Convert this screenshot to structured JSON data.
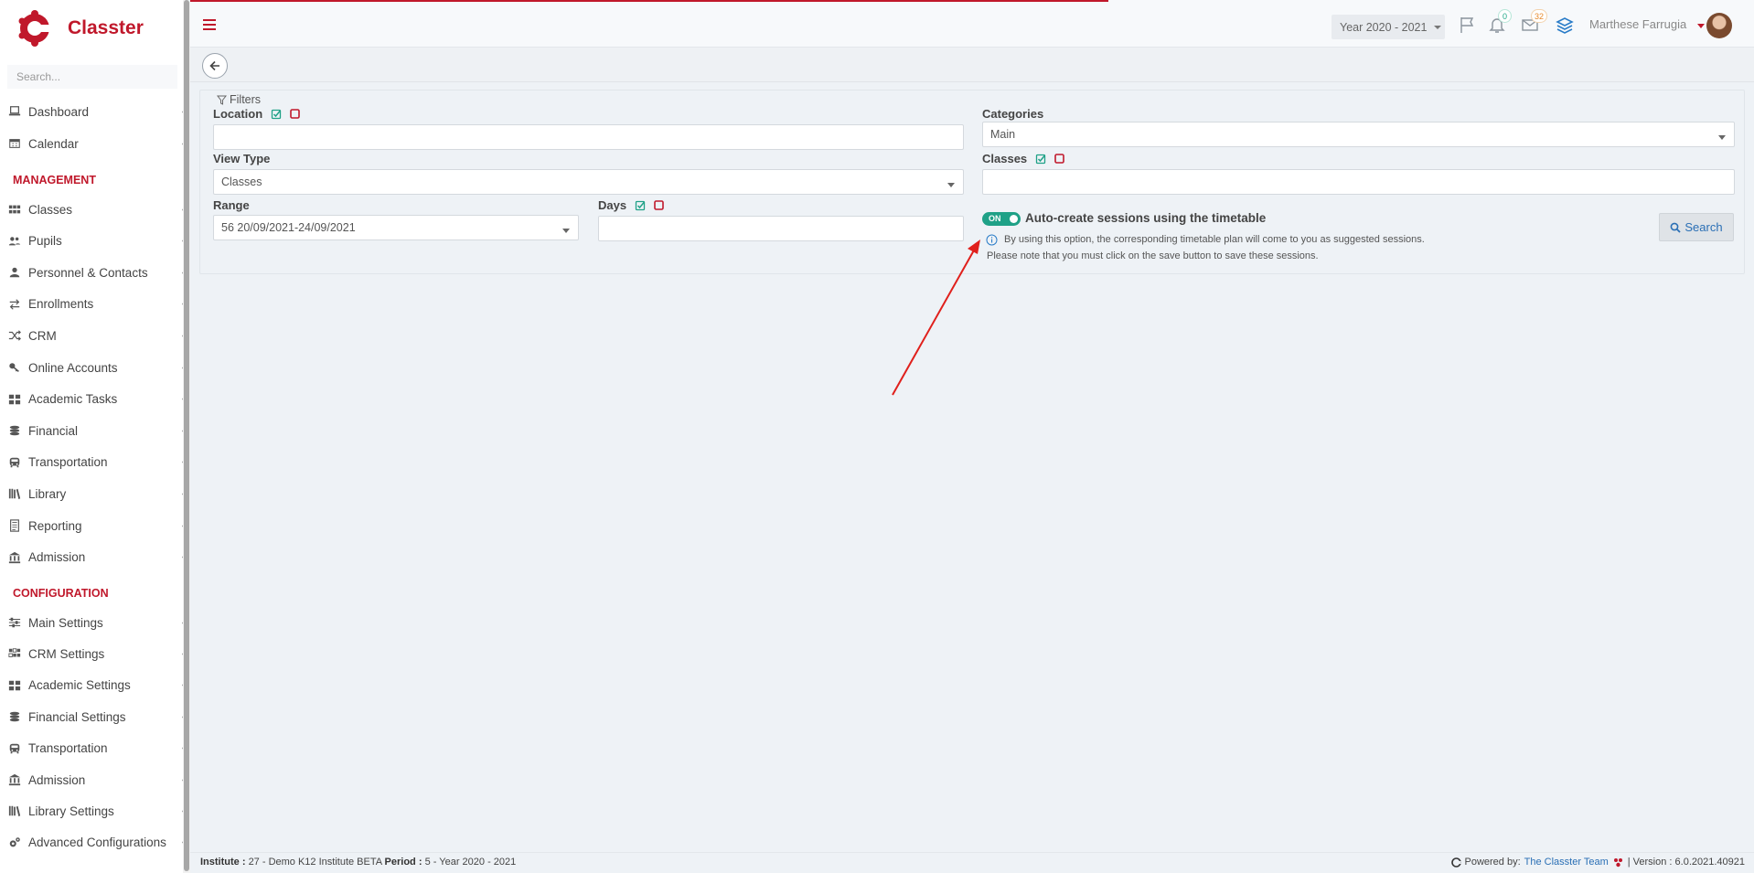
{
  "app": {
    "name": "Classter"
  },
  "sidebar": {
    "search_placeholder": "Search...",
    "items_top": [
      {
        "label": "Dashboard",
        "icon": "laptop-icon"
      },
      {
        "label": "Calendar",
        "icon": "calendar-icon"
      }
    ],
    "management_heading": "MANAGEMENT",
    "management_items": [
      {
        "label": "Classes",
        "icon": "classes-icon"
      },
      {
        "label": "Pupils",
        "icon": "pupils-icon"
      },
      {
        "label": "Personnel & Contacts",
        "icon": "person-icon"
      },
      {
        "label": "Enrollments",
        "icon": "exchange-icon"
      },
      {
        "label": "CRM",
        "icon": "shuffle-icon"
      },
      {
        "label": "Online Accounts",
        "icon": "key-icon"
      },
      {
        "label": "Academic Tasks",
        "icon": "grid-icon"
      },
      {
        "label": "Financial",
        "icon": "coins-icon"
      },
      {
        "label": "Transportation",
        "icon": "bus-icon"
      },
      {
        "label": "Library",
        "icon": "books-icon"
      },
      {
        "label": "Reporting",
        "icon": "report-icon"
      },
      {
        "label": "Admission",
        "icon": "institution-icon"
      }
    ],
    "configuration_heading": "CONFIGURATION",
    "configuration_items": [
      {
        "label": "Main Settings",
        "icon": "sliders-icon"
      },
      {
        "label": "CRM Settings",
        "icon": "crm-grid-icon"
      },
      {
        "label": "Academic Settings",
        "icon": "grid-icon"
      },
      {
        "label": "Financial Settings",
        "icon": "coins-icon"
      },
      {
        "label": "Transportation",
        "icon": "bus-icon"
      },
      {
        "label": "Admission",
        "icon": "institution-icon"
      },
      {
        "label": "Library Settings",
        "icon": "books-icon"
      },
      {
        "label": "Advanced Configurations",
        "icon": "gears-icon"
      }
    ]
  },
  "topbar": {
    "year_label": "Year 2020 - 2021",
    "notifications_count": "0",
    "messages_count": "32",
    "user_name": "Marthese Farrugia"
  },
  "filters": {
    "title": "Filters",
    "location_label": "Location",
    "location_value": "",
    "view_type_label": "View Type",
    "view_type_value": "Classes",
    "range_label": "Range",
    "range_value": "56 20/09/2021-24/09/2021",
    "days_label": "Days",
    "days_value": "",
    "categories_label": "Categories",
    "categories_value": "Main",
    "classes_label": "Classes",
    "classes_value": "",
    "toggle_state": "ON",
    "toggle_label": "Auto-create sessions using the timetable",
    "info_line1": "By using this option, the corresponding timetable plan will come to you as suggested sessions.",
    "info_line2": "Please note that you must click on the save button to save these sessions.",
    "search_label": "Search"
  },
  "footer": {
    "institute_label": "Institute :",
    "institute_value": "27 - Demo K12 Institute BETA",
    "period_label": "Period :",
    "period_value": "5 - Year 2020 - 2021",
    "powered_by": "Powered by:",
    "powered_link": "The Classter Team",
    "version": "| Version : 6.0.2021.40921"
  },
  "colors": {
    "brand": "#c0182b",
    "accent_green": "#1fa187",
    "link_blue": "#2a6fb5"
  }
}
